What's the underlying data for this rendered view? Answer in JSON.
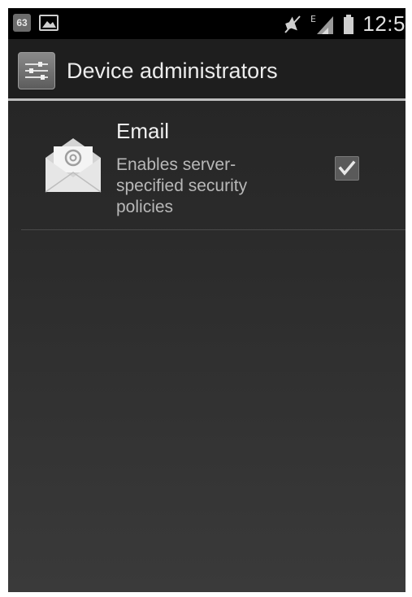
{
  "status_bar": {
    "notification_count": "63",
    "time": "12:5",
    "icons": [
      "notification-badge",
      "image-notification-icon",
      "mute-icon",
      "signal-edge-icon",
      "battery-icon"
    ],
    "signal_label": "E"
  },
  "action_bar": {
    "title": "Device administrators",
    "icon": "settings-sliders-icon"
  },
  "list": {
    "items": [
      {
        "title": "Email",
        "summary": "Enables server-specified security policies",
        "icon": "email-envelope-icon",
        "checked": true
      }
    ]
  },
  "colors": {
    "background_top": "#232323",
    "background_bottom": "#3a3a3a",
    "action_bar": "#1e1e1e",
    "divider": "#bdbdbd"
  }
}
